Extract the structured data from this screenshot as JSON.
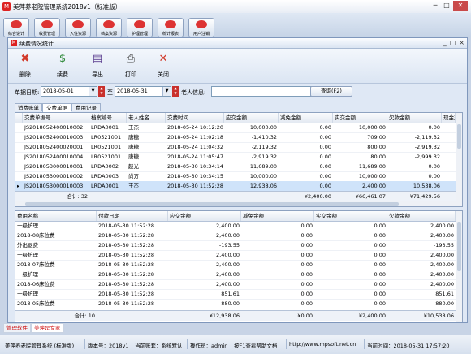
{
  "app": {
    "title": "美萍养老院管理系统2018v1（标准版）"
  },
  "main_toolbar": {
    "buttons": [
      "综合设计",
      "收费管理",
      "入住资源",
      "档案资源",
      "护理管理",
      "统计报表",
      "用户注销"
    ]
  },
  "window": {
    "title": "续费情况统计",
    "controls": [
      "_",
      "□",
      "×"
    ]
  },
  "toolbar": {
    "buttons": [
      {
        "label": "删除",
        "icon": "delete-icon",
        "glyph": "✖",
        "color": "#d23a2a"
      },
      {
        "label": "续费",
        "icon": "coins-icon",
        "glyph": "$",
        "color": "#2f8a3a"
      },
      {
        "label": "导出",
        "icon": "save-icon",
        "glyph": "▤",
        "color": "#5a3d8f"
      },
      {
        "label": "打印",
        "icon": "printer-icon",
        "glyph": "⎙",
        "color": "#444444"
      },
      {
        "label": "关闭",
        "icon": "close-icon",
        "glyph": "✕",
        "color": "#d23a2a"
      }
    ]
  },
  "filter": {
    "date_label": "单据日期:",
    "from": "2018-05-01",
    "to_label": "至",
    "to": "2018-05-31",
    "elder_label": "老人信息:",
    "elder_value": "",
    "query_button": "查询(F2)"
  },
  "tabs": [
    "消费账单",
    "交费单据",
    "费用记录"
  ],
  "active_tab": 1,
  "top_grid": {
    "columns": [
      "交费单据号",
      "档案编号",
      "老人姓名",
      "交费时间",
      "应交金额",
      "减免金额",
      "实交金额",
      "欠款金额",
      "现金支付"
    ],
    "rows": [
      [
        "JS2018052400010002",
        "LRDA0001",
        "王杰",
        "2018-05-24 10:12:20",
        "10,000.00",
        "0.00",
        "10,000.00",
        "0.00",
        ""
      ],
      [
        "JS2018052400010003",
        "LR0521001",
        "唐糖",
        "2018-05-24 11:02:18",
        "-1,410.32",
        "0.00",
        "709.00",
        "-2,119.32",
        ""
      ],
      [
        "JS2018052400020001",
        "LR0521001",
        "唐糖",
        "2018-05-24 11:04:32",
        "-2,119.32",
        "0.00",
        "800.00",
        "-2,919.32",
        ""
      ],
      [
        "JS2018052400010004",
        "LR0521001",
        "唐糖",
        "2018-05-24 11:05:47",
        "-2,919.32",
        "0.00",
        "80.00",
        "-2,999.32",
        ""
      ],
      [
        "JS2018053000010001",
        "LRDA0002",
        "赵光",
        "2018-05-30 10:34:14",
        "11,689.00",
        "0.00",
        "11,689.00",
        "0.00",
        ""
      ],
      [
        "JS2018053000010002",
        "LRDA0003",
        "尚方",
        "2018-05-30 10:34:15",
        "10,000.00",
        "0.00",
        "10,000.00",
        "0.00",
        ""
      ],
      [
        "JS2018053000010003",
        "LRDA0001",
        "王杰",
        "2018-05-30 11:52:28",
        "12,938.06",
        "0.00",
        "2,400.00",
        "10,538.06",
        ""
      ]
    ],
    "selected_row": 6,
    "footer": {
      "count_label": "合计: 32",
      "reduce_total": "¥2,400.00",
      "paid_total": "¥66,461.07",
      "debt_total": "¥71,429.56"
    }
  },
  "bottom_grid": {
    "columns": [
      "费用名称",
      "付款日期",
      "应交金额",
      "减免金额",
      "实交金额",
      "欠款金额"
    ],
    "rows": [
      [
        "一级护理",
        "2018-05-30 11:52:28",
        "2,400.00",
        "0.00",
        "0.00",
        "2,400.00"
      ],
      [
        "2018-08床位费",
        "2018-05-30 11:52:28",
        "2,400.00",
        "0.00",
        "0.00",
        "2,400.00"
      ],
      [
        "外出退费",
        "2018-05-30 11:52:28",
        "-193.55",
        "0.00",
        "0.00",
        "-193.55"
      ],
      [
        "一级护理",
        "2018-05-30 11:52:28",
        "2,400.00",
        "0.00",
        "0.00",
        "2,400.00"
      ],
      [
        "2018-07床位费",
        "2018-05-30 11:52:28",
        "2,400.00",
        "0.00",
        "0.00",
        "2,400.00"
      ],
      [
        "一级护理",
        "2018-05-30 11:52:28",
        "2,400.00",
        "0.00",
        "0.00",
        "2,400.00"
      ],
      [
        "2018-06床位费",
        "2018-05-30 11:52:28",
        "2,400.00",
        "0.00",
        "0.00",
        "2,400.00"
      ],
      [
        "一级护理",
        "2018-05-30 11:52:28",
        "851.61",
        "0.00",
        "0.00",
        "851.61"
      ],
      [
        "2018-05床位费",
        "2018-05-30 11:52:28",
        "880.00",
        "0.00",
        "0.00",
        "880.00"
      ]
    ],
    "footer": {
      "count_label": "合计: 10",
      "due_total": "¥12,938.06",
      "reduce_total": "¥0.00",
      "paid_total": "¥2,400.00",
      "debt_total": "¥10,538.06"
    }
  },
  "bottom_tabs": [
    "管理软件",
    "美萍是专家"
  ],
  "status": {
    "app_name": "美萍养老院管理系统 (标准版)",
    "version": "版本号：2018v1",
    "account": "当前账套：系统默认",
    "operator": "操作员：admin",
    "help": "按F1查看帮助文档",
    "url": "http://www.mpsoft.net.cn",
    "time": "当前时间：2018-05-31 17:57:20"
  }
}
